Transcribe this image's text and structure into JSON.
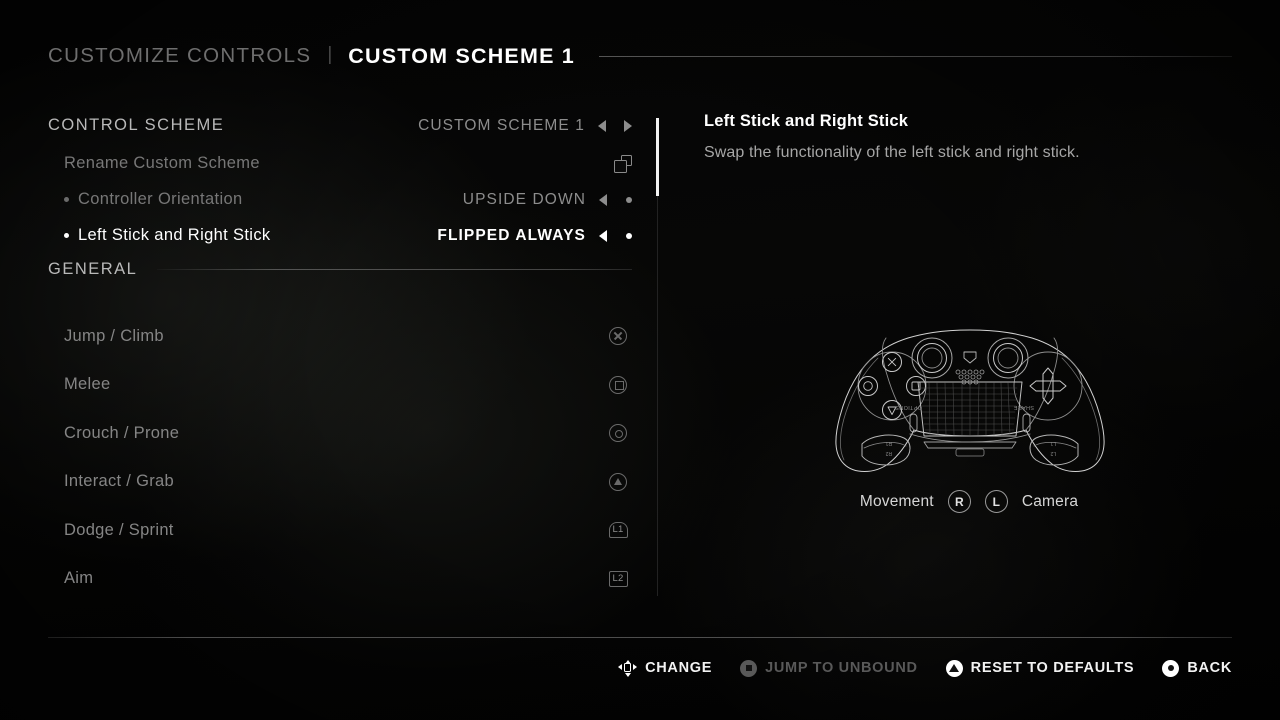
{
  "header": {
    "breadcrumb_parent": "CUSTOMIZE CONTROLS",
    "breadcrumb_separator": "|",
    "breadcrumb_current": "CUSTOM SCHEME 1"
  },
  "options": {
    "scheme_label": "CONTROL SCHEME",
    "scheme_value": "CUSTOM SCHEME 1",
    "rename_label": "Rename Custom Scheme",
    "rename_icon": "copy-icon",
    "orientation_label": "Controller Orientation",
    "orientation_value": "UPSIDE DOWN",
    "sticks_label": "Left Stick and Right Stick",
    "sticks_value": "FLIPPED ALWAYS"
  },
  "general": {
    "section_title": "GENERAL",
    "bindings": [
      {
        "action": "Jump / Climb",
        "button": "X",
        "icon": "cross-button-icon"
      },
      {
        "action": "Melee",
        "button": "Square",
        "icon": "square-button-icon"
      },
      {
        "action": "Crouch / Prone",
        "button": "Circle",
        "icon": "circle-button-icon"
      },
      {
        "action": "Interact / Grab",
        "button": "Triangle",
        "icon": "triangle-button-icon"
      },
      {
        "action": "Dodge / Sprint",
        "button": "L1",
        "icon": "l1-shoulder-icon"
      },
      {
        "action": "Aim",
        "button": "L2",
        "icon": "l2-trigger-icon"
      }
    ]
  },
  "detail": {
    "title": "Left Stick and Right Stick",
    "description": "Swap the functionality of the left stick and right stick.",
    "diagram_name": "dualshock-controller-upside-down",
    "legend": {
      "left_label": "Movement",
      "left_badge": "R",
      "right_badge": "L",
      "right_label": "Camera"
    }
  },
  "footer": {
    "actions": [
      {
        "label": "CHANGE",
        "icon": "dpad-icon",
        "enabled": true
      },
      {
        "label": "JUMP TO UNBOUND",
        "icon": "square-button-icon",
        "enabled": false
      },
      {
        "label": "RESET TO DEFAULTS",
        "icon": "triangle-button-icon",
        "enabled": true
      },
      {
        "label": "BACK",
        "icon": "circle-button-icon",
        "enabled": true
      }
    ]
  },
  "colors": {
    "background": "#000000",
    "text_bright": "#ffffff",
    "text_dim": "#777777",
    "text_muted": "#858585",
    "rule": "#969696",
    "scrollbar_thumb": "#f2f2f2"
  }
}
